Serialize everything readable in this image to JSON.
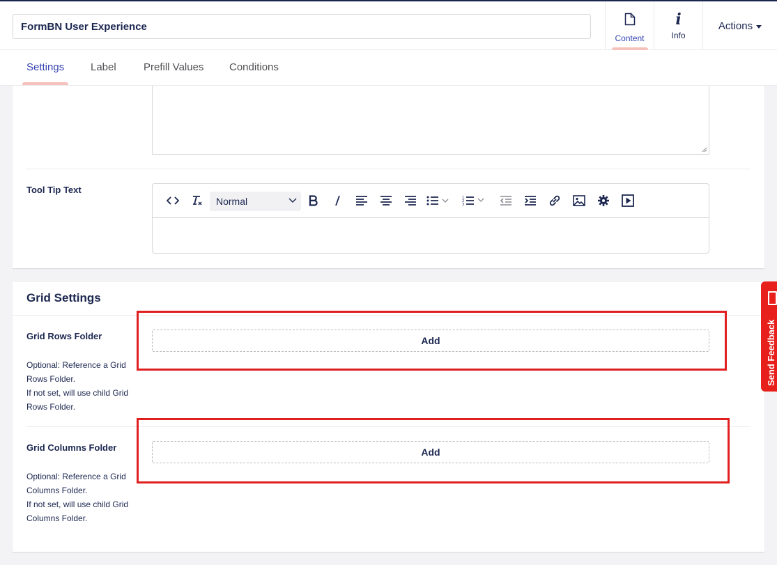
{
  "header": {
    "name_value": "FormBN User Experience",
    "content_label": "Content",
    "info_label": "Info",
    "actions_label": "Actions"
  },
  "tabs": [
    {
      "label": "Settings",
      "active": true
    },
    {
      "label": "Label",
      "active": false
    },
    {
      "label": "Prefill Values",
      "active": false
    },
    {
      "label": "Conditions",
      "active": false
    }
  ],
  "tooltip": {
    "label": "Tool Tip Text",
    "format_value": "Normal"
  },
  "grid_settings": {
    "title": "Grid Settings",
    "rows_folder": {
      "label": "Grid Rows Folder",
      "add_label": "Add",
      "desc_line1": "Optional: Reference a Grid Rows Folder.",
      "desc_line2": "If not set, will use child Grid Rows Folder."
    },
    "columns_folder": {
      "label": "Grid Columns Folder",
      "add_label": "Add",
      "desc_line1": "Optional: Reference a Grid Columns Folder.",
      "desc_line2": "If not set, will use child Grid Columns Folder."
    }
  },
  "feedback": {
    "label": "Send Feedback"
  },
  "colors": {
    "primary": "#1b264f",
    "active_tab": "#3544b1",
    "tab_indicator": "#f5c1bc",
    "highlight": "#e02020",
    "feedback": "#e8201c"
  }
}
